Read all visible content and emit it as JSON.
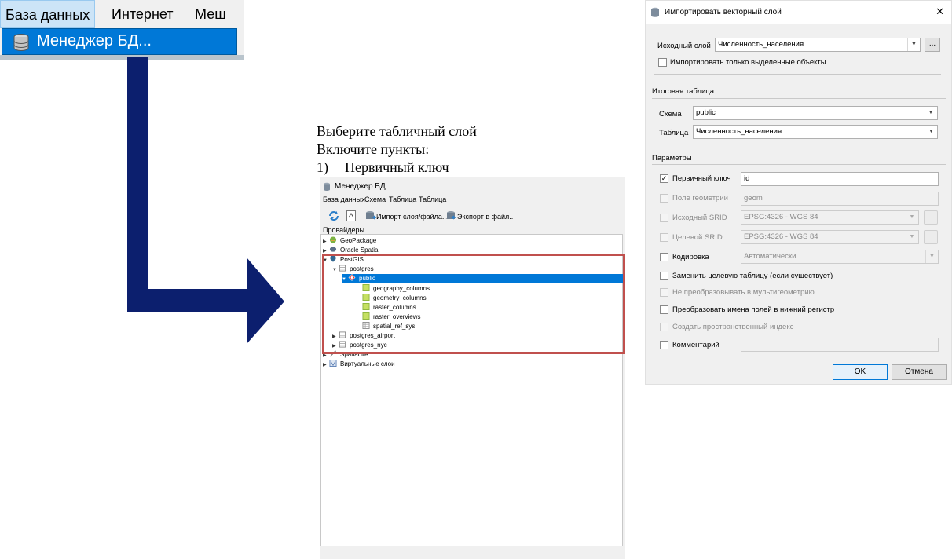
{
  "menu_crop": {
    "items": [
      "База данных",
      "Интернет",
      "Меш"
    ],
    "dropdown_item": "Менеджер БД..."
  },
  "instructions": {
    "line1": "Выберите табличный слой",
    "line2": "Включите пункты:",
    "item_num": "1)",
    "item_text": "Первичный ключ"
  },
  "db_manager": {
    "title": "Менеджер БД",
    "menu": [
      "База данных",
      "Схема",
      "Таблица",
      "Таблица"
    ],
    "toolbar": {
      "import": "Импорт слоя/файла...",
      "export": "Экспорт в файл..."
    },
    "providers_label": "Провайдеры",
    "tree": {
      "geopackage": "GeoPackage",
      "oracle": "Oracle Spatial",
      "postgis": "PostGIS",
      "postgres": "postgres",
      "public": "public",
      "tables": [
        "geography_columns",
        "geometry_columns",
        "raster_columns",
        "raster_overviews",
        "spatial_ref_sys"
      ],
      "postgres_airport": "postgres_airport",
      "postgres_nyc": "postgres_nyc",
      "spatialite": "SpatiaLite",
      "virtual": "Виртуальные слои"
    },
    "colors": {
      "highlight": "#0078d7",
      "redbox": "#c0504d"
    }
  },
  "import_dialog": {
    "title": "Импортировать векторный слой",
    "close": "✕",
    "source_label": "Исходный слой",
    "source_value": "Численность_населения",
    "browse": "...",
    "only_selected": "Импортировать только выделенные объекты",
    "output_group": "Итоговая таблица",
    "schema_label": "Схема",
    "schema_value": "public",
    "table_label": "Таблица",
    "table_value": "Численность_населения",
    "params_group": "Параметры",
    "pk_label": "Первичный ключ",
    "pk_value": "id",
    "pk_checked": true,
    "geom_label": "Поле геометрии",
    "geom_value": "geom",
    "src_srid_label": "Исходный SRID",
    "src_srid_value": "EPSG:4326 - WGS 84",
    "tgt_srid_label": "Целевой SRID",
    "tgt_srid_value": "EPSG:4326 - WGS 84",
    "encoding_label": "Кодировка",
    "encoding_value": "Автоматически",
    "replace_label": "Заменить целевую таблицу (если существует)",
    "no_multi_label": "Не преобразовывать в мультигеометрию",
    "lowercase_label": "Преобразовать имена полей в нижний регистр",
    "spatial_index_label": "Создать пространственный индекс",
    "comment_label": "Комментарий",
    "ok": "OK",
    "cancel": "Отмена"
  },
  "arrow_color": "#0c1f6e"
}
